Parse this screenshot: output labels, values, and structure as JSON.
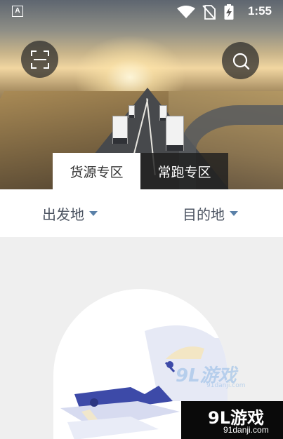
{
  "status_bar": {
    "carrier_badge": "A",
    "time": "1:55"
  },
  "header": {
    "scan_icon": "scan-icon",
    "search_icon": "search-icon"
  },
  "tabs": [
    {
      "label": "货源专区",
      "active": true
    },
    {
      "label": "常跑专区",
      "active": false
    }
  ],
  "filters": {
    "origin_label": "出发地",
    "destination_label": "目的地"
  },
  "watermark": {
    "logo_text": "9L游戏",
    "url": "91danji.com"
  },
  "brand": {
    "logo_text": "9L游戏",
    "url": "91danji.com"
  },
  "colors": {
    "tab_active_bg": "#ffffff",
    "tab_inactive_bg": "#1e1e1e",
    "filter_caret": "#5a80a8",
    "filter_text": "#4a5260",
    "page_bg": "#efefef",
    "illustration_accent": "#3d4aa8"
  }
}
